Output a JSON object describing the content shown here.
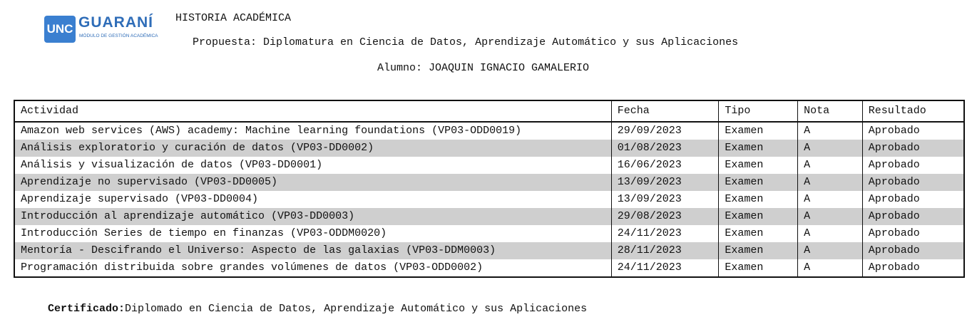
{
  "logo": {
    "badge": "UNC",
    "name": "GUARANÍ",
    "subtitle": "MÓDULO DE GESTIÓN ACADÉMICA"
  },
  "header": {
    "title": "HISTORIA ACADÉMICA",
    "propuesta": "Propuesta: Diplomatura en Ciencia de Datos, Aprendizaje Automático y sus Aplicaciones",
    "alumno": "Alumno: JOAQUIN IGNACIO GAMALERIO"
  },
  "table": {
    "columns": [
      "Actividad",
      "Fecha",
      "Tipo",
      "Nota",
      "Resultado"
    ],
    "rows": [
      [
        "Amazon web services (AWS) academy: Machine learning foundations (VP03-ODD0019)",
        "29/09/2023",
        "Examen",
        "A",
        "Aprobado"
      ],
      [
        "Análisis exploratorio y curación de datos (VP03-DD0002)",
        "01/08/2023",
        "Examen",
        "A",
        "Aprobado"
      ],
      [
        "Análisis y visualización de datos (VP03-DD0001)",
        "16/06/2023",
        "Examen",
        "A",
        "Aprobado"
      ],
      [
        "Aprendizaje no supervisado (VP03-DD0005)",
        "13/09/2023",
        "Examen",
        "A",
        "Aprobado"
      ],
      [
        "Aprendizaje supervisado (VP03-DD0004)",
        "13/09/2023",
        "Examen",
        "A",
        "Aprobado"
      ],
      [
        "Introducción al aprendizaje automático (VP03-DD0003)",
        "29/08/2023",
        "Examen",
        "A",
        "Aprobado"
      ],
      [
        "Introducción Series de tiempo en finanzas (VP03-ODDM0020)",
        "24/11/2023",
        "Examen",
        "A",
        "Aprobado"
      ],
      [
        "Mentoría - Descifrando el Universo: Aspecto de las galaxias (VP03-DDM0003)",
        "28/11/2023",
        "Examen",
        "A",
        "Aprobado"
      ],
      [
        "Programación distribuida sobre grandes volúmenes de datos (VP03-ODD0002)",
        "24/11/2023",
        "Examen",
        "A",
        "Aprobado"
      ]
    ]
  },
  "certificate": {
    "label": "Certificado:",
    "value": "Diplomado en Ciencia de Datos, Aprendizaje Automático y sus Aplicaciones"
  }
}
